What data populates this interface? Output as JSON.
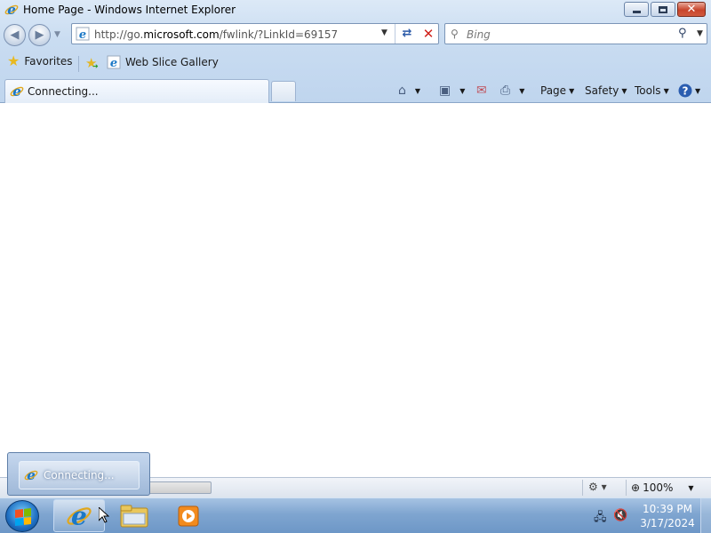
{
  "window": {
    "title": "Home Page - Windows Internet Explorer",
    "minimize_glyph": "",
    "close_glyph": "✕"
  },
  "address": {
    "prefix": "http://go.",
    "domain": "microsoft.com",
    "path": "/fwlink/?LinkId=69157"
  },
  "search": {
    "placeholder": "Bing"
  },
  "favorites_bar": {
    "favorites_label": "Favorites",
    "web_slice_label": "Web Slice Gallery"
  },
  "tabs": [
    {
      "label": "Connecting..."
    }
  ],
  "command_bar": {
    "page_label": "Page",
    "safety_label": "Safety",
    "tools_label": "Tools"
  },
  "status_bar": {
    "zoom": "100%"
  },
  "taskbar": {
    "clock_time": "10:39 PM",
    "clock_date": "3/17/2024",
    "thumbnail_label": "Connecting..."
  },
  "colors": {
    "chrome": "#c9dcf1",
    "taskbar": "#7fa5d0",
    "close_button": "#c8452c",
    "ie_blue": "#1b78c6"
  }
}
